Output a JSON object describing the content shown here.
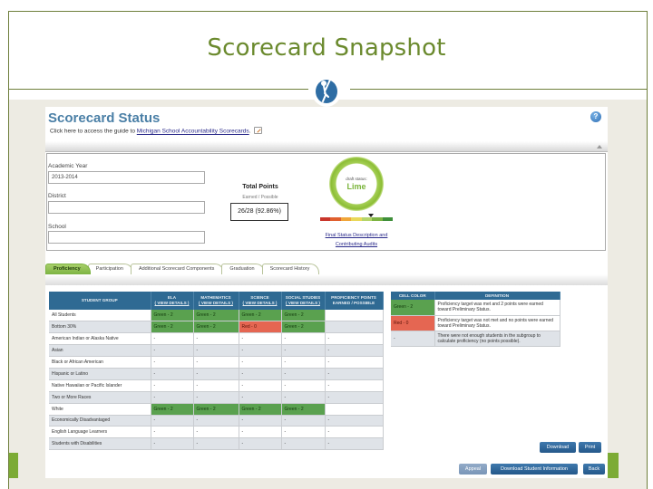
{
  "slide": {
    "title": "Scorecard Snapshot",
    "logo_icon": "mde-child-reaching-logo"
  },
  "app": {
    "title": "Scorecard Status",
    "guide_prefix": "Click here to access the guide to ",
    "guide_link": "Michigan School Accountability Scorecards",
    "guide_suffix": ".",
    "help_icon": "?"
  },
  "filters": {
    "academic_year_label": "Academic Year",
    "academic_year_value": "2013-2014",
    "district_label": "District",
    "district_value": "",
    "school_label": "School",
    "school_value": ""
  },
  "total_points": {
    "title": "Total Points",
    "subtitle": "Earned / Possible",
    "value": "26/28 (92.86%)"
  },
  "status": {
    "small_label": "draft status:",
    "label": "Lime",
    "scale_colors": [
      "#c9362b",
      "#e0602f",
      "#f0a63a",
      "#e9d85a",
      "#b5d56a",
      "#7cb342",
      "#3f8f3a"
    ],
    "marker_position_index": 5,
    "link_line1": "Final Status Description and",
    "link_line2": "Contributing Audits"
  },
  "tabs": [
    {
      "label": "Proficiency",
      "active": true
    },
    {
      "label": "Participation",
      "active": false
    },
    {
      "label": "Additional Scorecard Components",
      "active": false
    },
    {
      "label": "Graduation",
      "active": false
    },
    {
      "label": "Scorecard History",
      "active": false
    }
  ],
  "proficiency_table": {
    "headers": {
      "group": "STUDENT GROUP",
      "ela": "ELA",
      "math": "MATHEMATICS",
      "science": "SCIENCE",
      "social": "SOCIAL STUDIES",
      "view_details": "( VIEW DETAILS )",
      "points_line1": "PROFICIENCY POINTS",
      "points_line2": "EARNED / POSSIBLE"
    },
    "rows": [
      {
        "group": "All Students",
        "ela": "Green - 2",
        "math": "Green - 2",
        "science": "Green - 2",
        "social": "Green - 2",
        "points": ""
      },
      {
        "group": "Bottom 30%",
        "ela": "Green - 2",
        "math": "Green - 2",
        "science": "Red - 0",
        "social": "Green - 2",
        "points": ""
      },
      {
        "group": "American Indian or Alaska Native",
        "ela": "-",
        "math": "-",
        "science": "-",
        "social": "-",
        "points": "-"
      },
      {
        "group": "Asian",
        "ela": "-",
        "math": "-",
        "science": "-",
        "social": "-",
        "points": "-"
      },
      {
        "group": "Black or African American",
        "ela": "-",
        "math": "-",
        "science": "-",
        "social": "-",
        "points": "-"
      },
      {
        "group": "Hispanic or Latino",
        "ela": "-",
        "math": "-",
        "science": "-",
        "social": "-",
        "points": "-"
      },
      {
        "group": "Native Hawaiian or Pacific Islander",
        "ela": "-",
        "math": "-",
        "science": "-",
        "social": "-",
        "points": "-"
      },
      {
        "group": "Two or More Races",
        "ela": "-",
        "math": "-",
        "science": "-",
        "social": "-",
        "points": "-"
      },
      {
        "group": "White",
        "ela": "Green - 2",
        "math": "Green - 2",
        "science": "Green - 2",
        "social": "Green - 2",
        "points": ""
      },
      {
        "group": "Economically Disadvantaged",
        "ela": "-",
        "math": "-",
        "science": "-",
        "social": "-",
        "points": "-"
      },
      {
        "group": "English Language Learners",
        "ela": "-",
        "math": "-",
        "science": "-",
        "social": "-",
        "points": "-"
      },
      {
        "group": "Students with Disabilities",
        "ela": "-",
        "math": "-",
        "science": "-",
        "social": "-",
        "points": "-"
      }
    ]
  },
  "legend_table": {
    "headers": {
      "color": "CELL COLOR",
      "definition": "DEFINITION"
    },
    "rows": [
      {
        "color": "Green - 2",
        "definition": "Proficiency target was met and 2 points were earned toward Preliminary Status."
      },
      {
        "color": "Red - 0",
        "definition": "Proficiency target was not met and no points were earned toward Preliminary Status."
      },
      {
        "color": "-",
        "definition": "There were not enough students in the subgroup to calculate proficiency (no points possible)."
      }
    ]
  },
  "buttons": {
    "download": "Download",
    "print": "Print",
    "appeal": "Appeal",
    "download_student": "Download Student Information",
    "back": "Back"
  }
}
